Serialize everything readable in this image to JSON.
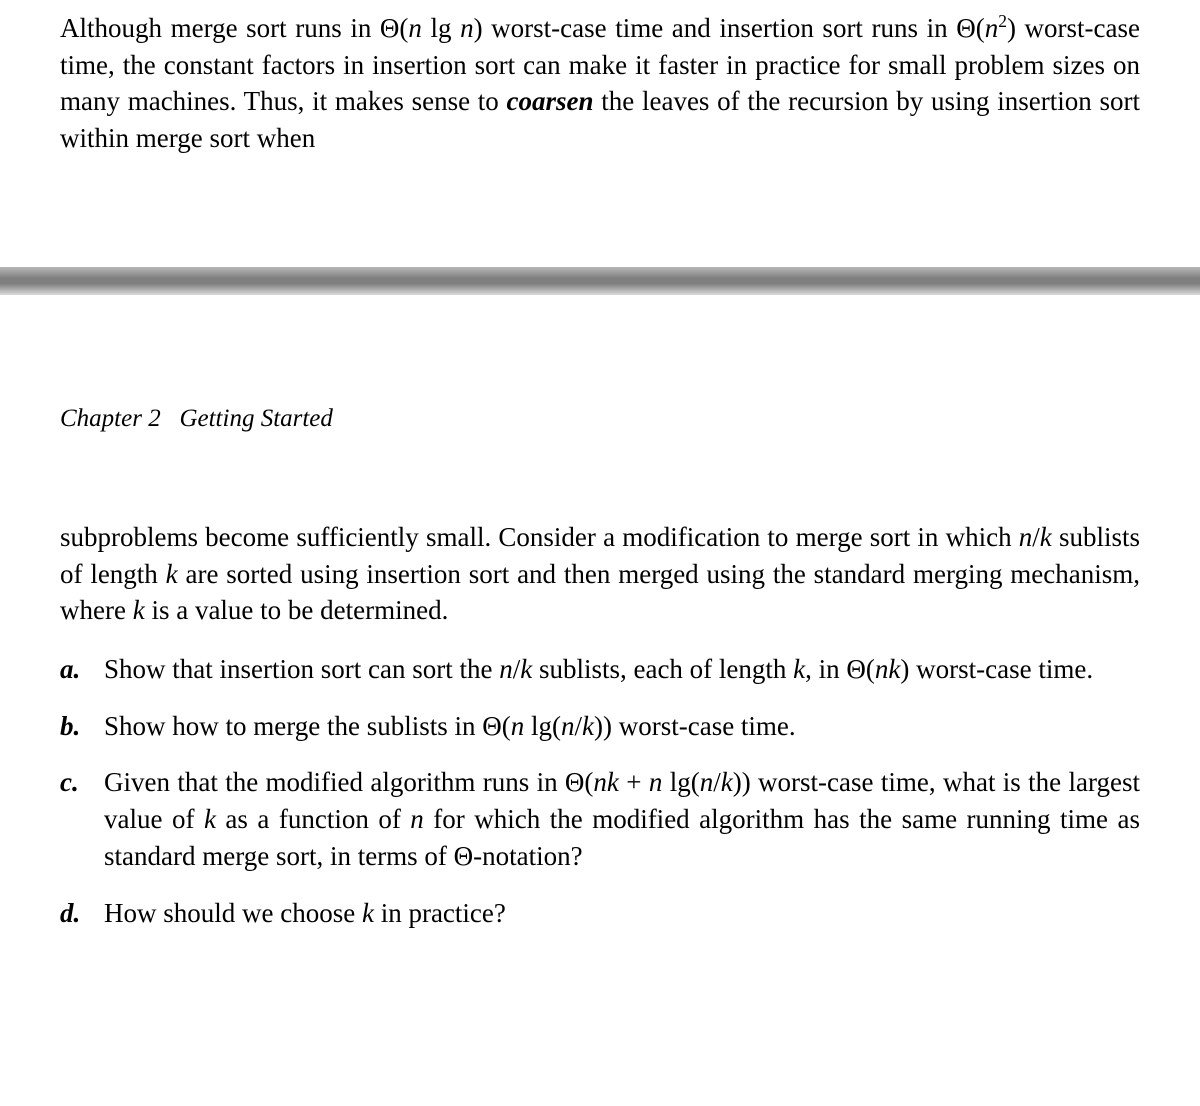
{
  "top_paragraph": {
    "t1": "Although merge sort runs in Θ(",
    "t2": "n",
    "t3": " lg ",
    "t4": "n",
    "t5": ") worst-case time and insertion sort runs in Θ(",
    "t6": "n",
    "t7": "2",
    "t8": ") worst-case time, the constant factors in insertion sort can make it faster in practice for small problem sizes on many machines.  Thus, it makes sense to ",
    "t9": "coarsen",
    "t10": " the leaves of the recursion by using insertion sort within merge sort when"
  },
  "chapter_header": {
    "chapter": "Chapter 2",
    "title": "Getting Started"
  },
  "cont_paragraph": {
    "t1": "subproblems become sufficiently small.  Consider a modification to merge sort in which ",
    "t2": "n",
    "t3": "/",
    "t4": "k",
    "t5": " sublists of length ",
    "t6": "k",
    "t7": " are sorted using insertion sort and then merged using the standard merging mechanism, where ",
    "t8": "k",
    "t9": " is a value to be determined."
  },
  "items": {
    "a": {
      "label": "a.",
      "t1": "Show that insertion sort can sort the ",
      "t2": "n",
      "t3": "/",
      "t4": "k",
      "t5": " sublists, each of length ",
      "t6": "k",
      "t7": ", in Θ(",
      "t8": "nk",
      "t9": ") worst-case time."
    },
    "b": {
      "label": "b.",
      "t1": "Show how to merge the sublists in Θ(",
      "t2": "n",
      "t3": " lg(",
      "t4": "n",
      "t5": "/",
      "t6": "k",
      "t7": ")) worst-case time."
    },
    "c": {
      "label": "c.",
      "t1": "Given that the modified algorithm runs in Θ(",
      "t2": "nk",
      "t3": " + ",
      "t4": "n",
      "t5": " lg(",
      "t6": "n",
      "t7": "/",
      "t8": "k",
      "t9": ")) worst-case time, what is the largest value of ",
      "t10": "k",
      "t11": " as a function of ",
      "t12": "n",
      "t13": " for which the modified algorithm has the same running time as standard merge sort, in terms of Θ-notation?"
    },
    "d": {
      "label": "d.",
      "t1": "How should we choose ",
      "t2": "k",
      "t3": " in practice?"
    }
  }
}
